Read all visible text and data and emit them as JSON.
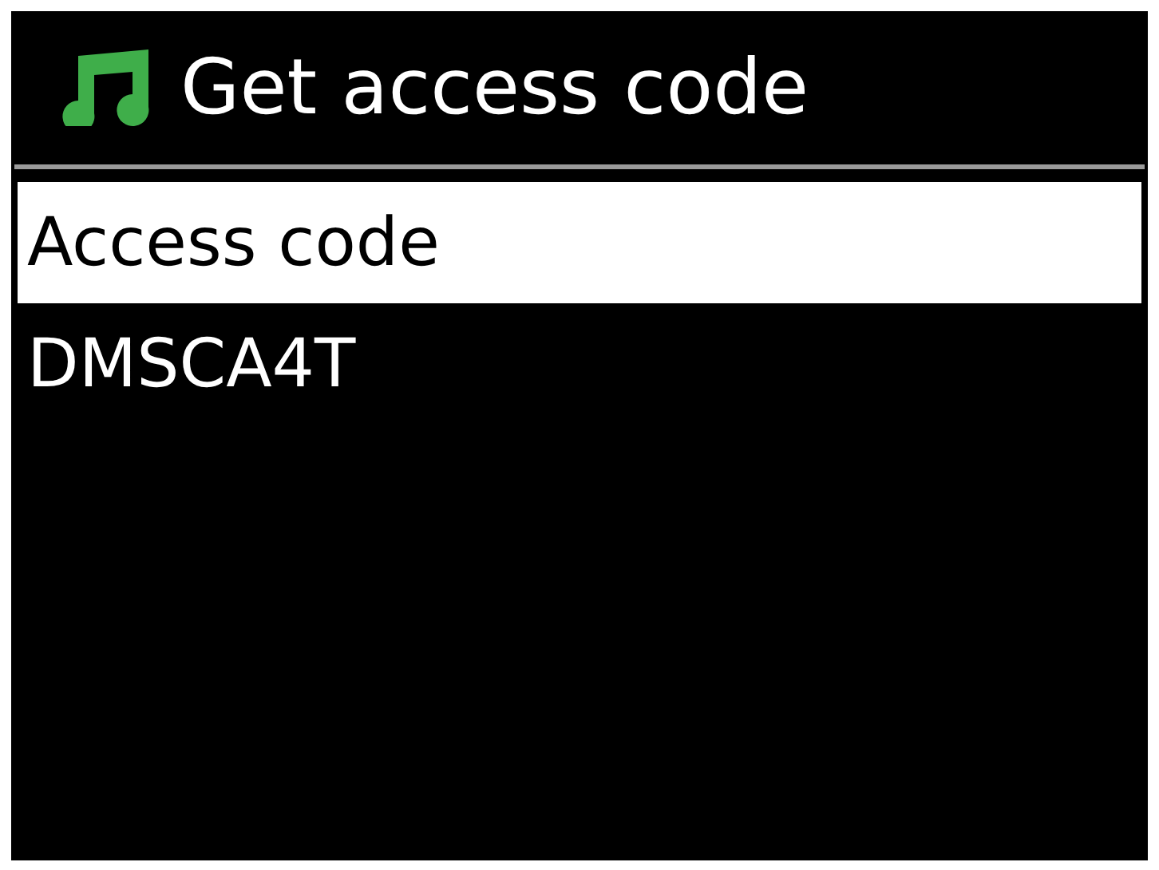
{
  "header": {
    "title": "Get access code"
  },
  "items": [
    {
      "label": "Access code",
      "selected": true
    },
    {
      "label": "DMSCA4T",
      "selected": false
    }
  ]
}
